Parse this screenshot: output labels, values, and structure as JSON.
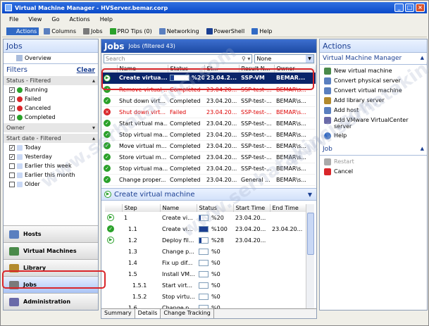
{
  "window": {
    "title": "Virtual Machine Manager - HVServer.bemar.corp"
  },
  "menu": [
    "File",
    "View",
    "Go",
    "Actions",
    "Help"
  ],
  "toolbar": [
    {
      "label": "Actions",
      "icon": "actions-icon",
      "active": true
    },
    {
      "label": "Columns",
      "icon": "columns-icon"
    },
    {
      "label": "Jobs",
      "icon": "jobs-icon"
    },
    {
      "label": "PRO Tips (0)",
      "icon": "pro-tips-icon"
    },
    {
      "label": "Networking",
      "icon": "networking-icon"
    },
    {
      "label": "PowerShell",
      "icon": "powershell-icon"
    },
    {
      "label": "Help",
      "icon": "help-icon"
    }
  ],
  "left": {
    "title": "Jobs",
    "overview": "Overview",
    "filters_label": "Filters",
    "clear_label": "Clear",
    "status_group": "Status - Filtered",
    "status_items": [
      {
        "label": "Running",
        "checked": true,
        "color": "#2aa12a"
      },
      {
        "label": "Failed",
        "checked": true,
        "color": "#d9262a"
      },
      {
        "label": "Canceled",
        "checked": true,
        "color": "#d9262a"
      },
      {
        "label": "Completed",
        "checked": true,
        "color": "#2aa12a"
      }
    ],
    "owner_group": "Owner",
    "date_group": "Start date - Filtered",
    "date_items": [
      {
        "label": "Today",
        "checked": true
      },
      {
        "label": "Yesterday",
        "checked": true
      },
      {
        "label": "Earlier this week",
        "checked": false
      },
      {
        "label": "Earlier this month",
        "checked": false
      },
      {
        "label": "Older",
        "checked": false
      }
    ],
    "nav": [
      {
        "label": "Hosts",
        "color": "#5a7fbf"
      },
      {
        "label": "Virtual Machines",
        "color": "#4a8a4a"
      },
      {
        "label": "Library",
        "color": "#b38a2d"
      },
      {
        "label": "Jobs",
        "color": "#7a7a7a",
        "selected": true
      },
      {
        "label": "Administration",
        "color": "#6a6aa8"
      }
    ]
  },
  "jobs": {
    "title": "Jobs",
    "subtitle": "Jobs (filtered 43)",
    "search_placeholder": "Search",
    "filter_value": "None",
    "columns": [
      "Name",
      "Status",
      "St...",
      "Result N...",
      "Owner"
    ],
    "rows": [
      {
        "state": "running",
        "name": "Create virtua...",
        "status": "%20",
        "progress": 0.2,
        "start": "23.04.2...",
        "result": "SSP-VM",
        "owner": "BEMAR...",
        "selected": true
      },
      {
        "state": "ok",
        "name": "Remove virtual ...",
        "status": "Completed",
        "start": "23.04.20...",
        "result": "SSP-test-...",
        "owner": "BEMAR\\s...",
        "strike": true
      },
      {
        "state": "ok",
        "name": "Shut down virt...",
        "status": "Completed",
        "start": "23.04.20...",
        "result": "SSP-test-...",
        "owner": "BEMAR\\s..."
      },
      {
        "state": "err",
        "name": "Shut down virt...",
        "status": "Failed",
        "start": "23.04.20...",
        "result": "SSP-test-...",
        "owner": "BEMAR\\s...",
        "failed": true
      },
      {
        "state": "ok",
        "name": "Start virtual ma...",
        "status": "Completed",
        "start": "23.04.20...",
        "result": "SSP-test-...",
        "owner": "BEMAR\\s..."
      },
      {
        "state": "ok",
        "name": "Stop virtual ma...",
        "status": "Completed",
        "start": "23.04.20...",
        "result": "SSP-test-...",
        "owner": "BEMAR\\s..."
      },
      {
        "state": "ok",
        "name": "Move virtual m...",
        "status": "Completed",
        "start": "23.04.20...",
        "result": "SSP-test-...",
        "owner": "BEMAR\\s..."
      },
      {
        "state": "ok",
        "name": "Store virtual m...",
        "status": "Completed",
        "start": "23.04.20...",
        "result": "SSP-test-...",
        "owner": "BEMAR\\s..."
      },
      {
        "state": "ok",
        "name": "Stop virtual ma...",
        "status": "Completed",
        "start": "23.04.20...",
        "result": "SSP-test-...",
        "owner": "BEMAR\\s..."
      },
      {
        "state": "ok",
        "name": "Change proper...",
        "status": "Completed",
        "start": "23.04.20...",
        "result": "General ...",
        "owner": "BEMAR\\s..."
      }
    ]
  },
  "details": {
    "title": "Create virtual machine",
    "columns": [
      "",
      "Step",
      "Name",
      "Status",
      "Start Time",
      "End Time"
    ],
    "rows": [
      {
        "state": "running",
        "step": "1",
        "name": "Create vi...",
        "status": "%20",
        "progress": 0.2,
        "start": "23.04.20...",
        "end": ""
      },
      {
        "state": "ok",
        "step": "1.1",
        "name": "Create vi...",
        "status": "%100",
        "progress": 1.0,
        "start": "23.04.20...",
        "end": "23.04.20..."
      },
      {
        "state": "running",
        "step": "1.2",
        "name": "Deploy fil...",
        "status": "%28",
        "progress": 0.28,
        "start": "23.04.20...",
        "end": ""
      },
      {
        "state": "",
        "step": "1.3",
        "name": "Change p...",
        "status": "%0",
        "progress": 0,
        "start": "",
        "end": ""
      },
      {
        "state": "",
        "step": "1.4",
        "name": "Fix up dif...",
        "status": "%0",
        "progress": 0,
        "start": "",
        "end": ""
      },
      {
        "state": "",
        "step": "1.5",
        "name": "Install VM...",
        "status": "%0",
        "progress": 0,
        "start": "",
        "end": ""
      },
      {
        "state": "",
        "step": "1.5.1",
        "name": "Start virt...",
        "status": "%0",
        "progress": 0,
        "start": "",
        "end": ""
      },
      {
        "state": "",
        "step": "1.5.2",
        "name": "Stop virtu...",
        "status": "%0",
        "progress": 0,
        "start": "",
        "end": ""
      },
      {
        "state": "",
        "step": "1.6",
        "name": "Change p...",
        "status": "%0",
        "progress": 0,
        "start": "",
        "end": ""
      }
    ],
    "tabs": [
      "Summary",
      "Details",
      "Change Tracking"
    ],
    "active_tab": 1
  },
  "actions": {
    "title": "Actions",
    "vmm_section": "Virtual Machine Manager",
    "vmm_items": [
      {
        "label": "New virtual machine",
        "icon": "new-vm-icon",
        "color": "#4a8a4a"
      },
      {
        "label": "Convert physical server",
        "icon": "convert-physical-icon",
        "color": "#5a7fbf"
      },
      {
        "label": "Convert virtual machine",
        "icon": "convert-vm-icon",
        "color": "#5a7fbf"
      },
      {
        "label": "Add library server",
        "icon": "library-icon",
        "color": "#b38a2d"
      },
      {
        "label": "Add host",
        "icon": "host-icon",
        "color": "#5a7fbf"
      },
      {
        "label": "Add VMware VirtualCenter server",
        "icon": "vmware-icon",
        "color": "#6a6aa8"
      },
      {
        "label": "Help",
        "icon": "help-icon",
        "color": "#316ac5"
      }
    ],
    "job_section": "Job",
    "job_items": [
      {
        "label": "Restart",
        "icon": "restart-icon",
        "color": "#aaaaaa",
        "disabled": true
      },
      {
        "label": "Cancel",
        "icon": "cancel-icon",
        "color": "#d9262a"
      }
    ]
  },
  "watermark_text": "www.serhatakinci.com"
}
